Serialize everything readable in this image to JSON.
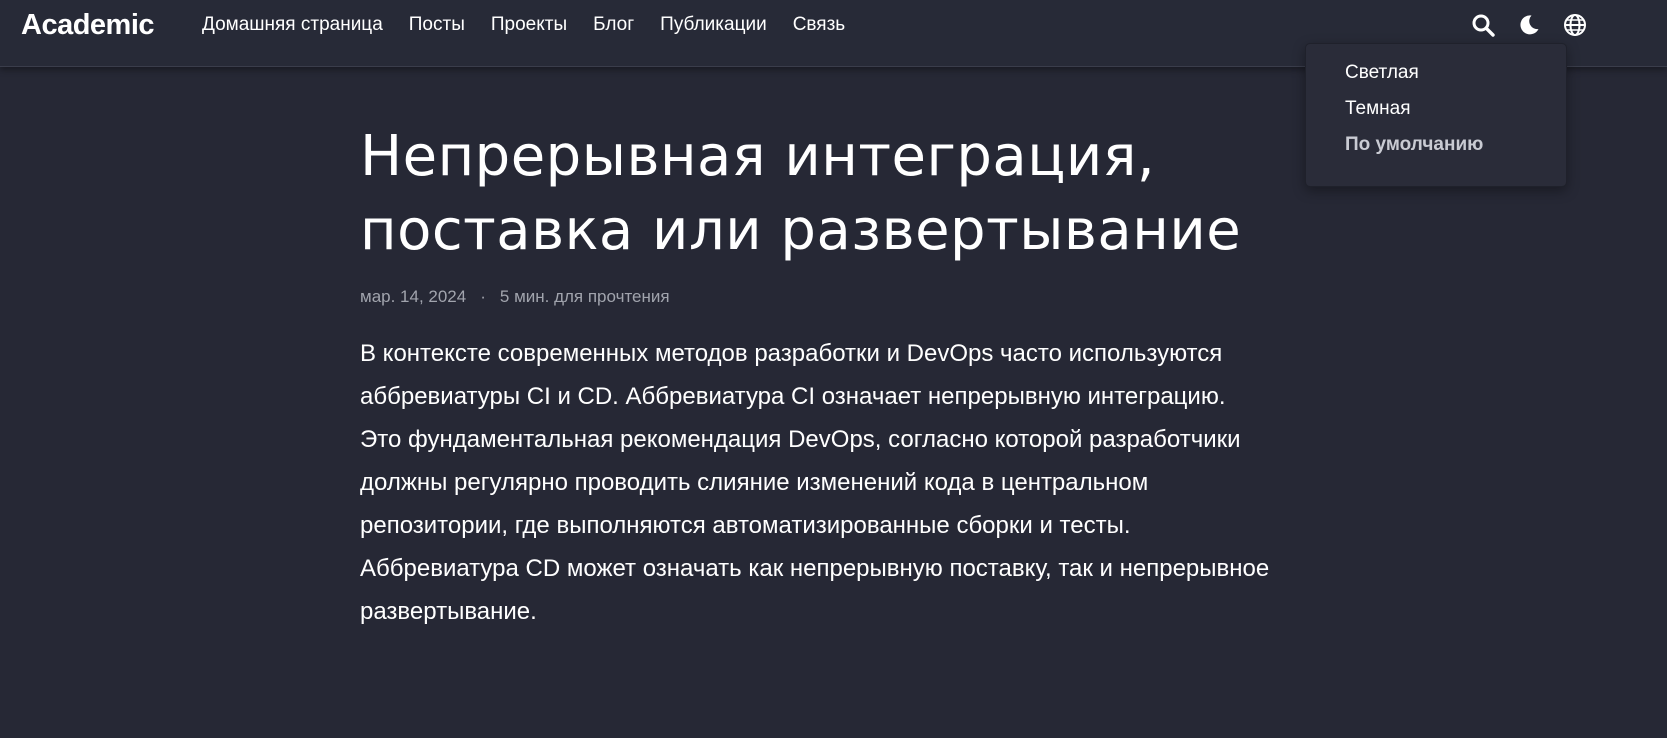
{
  "brand": "Academic",
  "nav": {
    "links": [
      "Домашняя страница",
      "Посты",
      "Проекты",
      "Блог",
      "Публикации",
      "Связь"
    ],
    "icons": [
      "search-icon",
      "moon-icon",
      "globe-icon"
    ]
  },
  "theme_menu": {
    "items": [
      "Светлая",
      "Темная",
      "По умолчанию"
    ],
    "active_index": 2
  },
  "article": {
    "title": "Непрерывная интеграция, поставка или развертывание",
    "date": "мар. 14, 2024",
    "separator": "·",
    "reading_time": "5 мин. для прочтения",
    "body": "В контексте современных методов разработки и DevOps часто используются аббревиатуры CI и CD. Аббревиатура CI означает непрерывную интеграцию. Это фундаментальная рекомендация DevOps, согласно которой разработчики должны регулярно проводить слияние изменений кода в центральном репозитории, где выполняются автоматизированные сборки и тесты. Аббревиатура CD может означать как непрерывную поставку, так и непрерывное развертывание."
  },
  "colors": {
    "background": "#262835",
    "navbar": "#272a37",
    "dropdown": "#2a2c39",
    "text": "#ffffff",
    "muted_text": "#a1a4ad"
  }
}
